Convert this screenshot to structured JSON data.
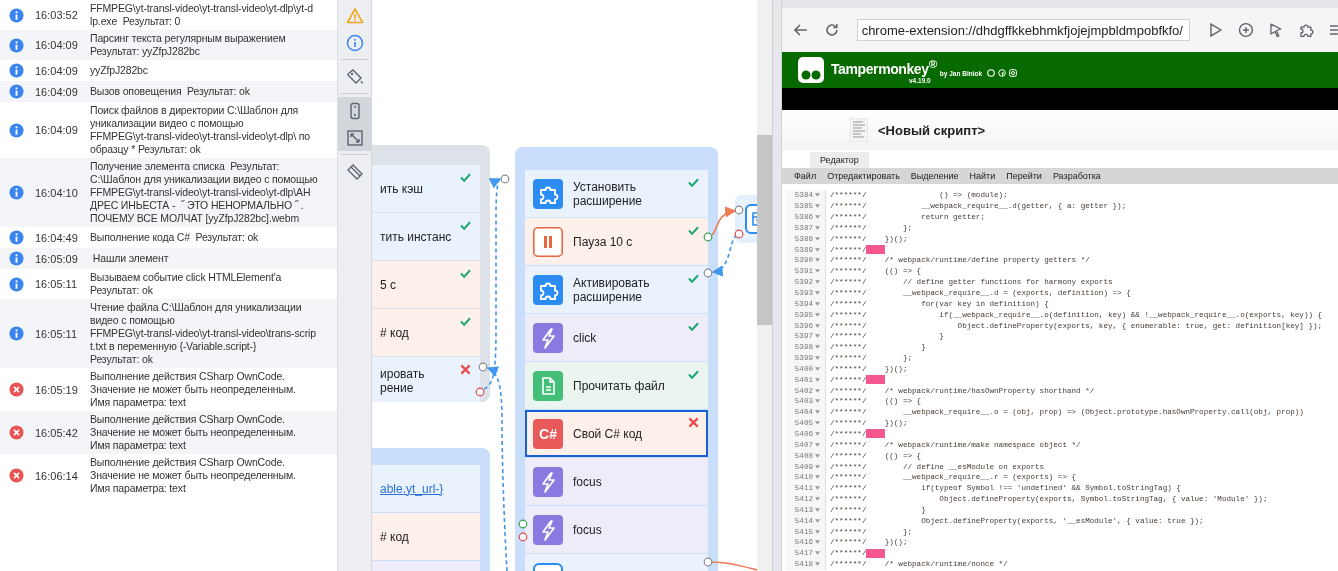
{
  "log": [
    {
      "kind": "info",
      "time": "16:03:52",
      "message": "FFMPEG\\yt-transl-video\\yt-transl-video\\yt-dlp\\yt-d\nlp.exe  Результат: 0"
    },
    {
      "kind": "info",
      "time": "16:04:09",
      "message": "Парсинг текста регулярным выражением\nРезультат: yyZfpJ282bc"
    },
    {
      "kind": "info",
      "time": "16:04:09",
      "message": "yyZfpJ282bc"
    },
    {
      "kind": "info",
      "time": "16:04:09",
      "message": "Вызов оповещения  Результат: ok"
    },
    {
      "kind": "info",
      "time": "16:04:09",
      "message": "Поиск файлов в директории C:\\Шаблон для\nуникализации видео с помощью\nFFMPEG\\yt-transl-video\\yt-transl-video\\yt-dlp\\ по\nобразцу * Результат: ok"
    },
    {
      "kind": "info",
      "time": "16:04:10",
      "message": "Получение элемента списка  Результат:\nC:\\Шаблон для уникализации видео с помощью\nFFMPEG\\yt-transl-video\\yt-transl-video\\yt-dlp\\АН\nДРЕС ИНЬЕСТА -  ˝ ЭТО НЕНОРМАЛЬНО ˝ .\nПОЧЕМУ ВСЕ МОЛЧАТ [yyZfpJ282bc].webm"
    },
    {
      "kind": "info",
      "time": "16:04:49",
      "message": "Выполнение кода C#  Результат: ok"
    },
    {
      "kind": "info",
      "time": "16:05:09",
      "message": " Нашли элемент"
    },
    {
      "kind": "info",
      "time": "16:05:11",
      "message": "Вызываем событие click HTMLElement'a\nРезультат: ok"
    },
    {
      "kind": "info",
      "time": "16:05:11",
      "message": "Чтение файла C:\\Шаблон для уникализации\nвидео с помощью\nFFMPEG\\yt-transl-video\\yt-transl-video\\trans-scrip\nt.txt в переменную {-Variable.script-}\nРезультат: ok"
    },
    {
      "kind": "error",
      "time": "16:05:19",
      "message": "Выполнение действия CSharp OwnCode.\nЗначение не может быть неопределенным.\nИмя параметра: text"
    },
    {
      "kind": "error",
      "time": "16:05:42",
      "message": "Выполнение действия CSharp OwnCode.\nЗначение не может быть неопределенным.\nИмя параметра: text"
    },
    {
      "kind": "error",
      "time": "16:06:14",
      "message": "Выполнение действия CSharp OwnCode.\nЗначение не может быть неопределенным.\nИмя параметра: text"
    }
  ],
  "tool_groups": [
    [
      {
        "kind": "warning",
        "selected": false
      },
      {
        "kind": "info",
        "selected": false
      }
    ],
    [
      {
        "kind": "tag",
        "selected": false
      }
    ],
    [
      {
        "kind": "phone",
        "selected": true
      },
      {
        "kind": "resize",
        "selected": true
      }
    ],
    [
      {
        "kind": "eraser",
        "selected": false
      }
    ]
  ],
  "canvas": {
    "groups": [
      {
        "color": "#dde1e8",
        "items": [
          {
            "kind": "extension",
            "icon": false,
            "link": false,
            "text": "ить кэш",
            "ok": true,
            "error": false,
            "selected": false
          },
          {
            "kind": "extension",
            "icon": false,
            "link": false,
            "text": "тить инстанс",
            "ok": true,
            "error": false,
            "selected": false
          },
          {
            "kind": "pause",
            "icon": false,
            "link": false,
            "text": "5 с",
            "ok": true,
            "error": false,
            "selected": false
          },
          {
            "kind": "csharp",
            "icon": false,
            "link": false,
            "text": "# код",
            "ok": true,
            "error": false,
            "selected": false
          },
          {
            "kind": "extension",
            "icon": false,
            "link": false,
            "text": "ировать\nрение",
            "ok": false,
            "error": true,
            "selected": false
          }
        ]
      },
      {
        "color": "#c8defa",
        "items": [
          {
            "kind": "extension",
            "icon": true,
            "link": false,
            "text": "Установить\nрасширение",
            "ok": true,
            "error": false,
            "selected": false
          },
          {
            "kind": "pause",
            "icon": true,
            "link": false,
            "text": "Пауза 10 с",
            "ok": true,
            "error": false,
            "selected": false
          },
          {
            "kind": "extension",
            "icon": true,
            "link": false,
            "text": "Активировать\nрасширение",
            "ok": true,
            "error": false,
            "selected": false
          },
          {
            "kind": "trigger",
            "icon": true,
            "link": false,
            "text": "click",
            "ok": true,
            "error": false,
            "selected": false
          },
          {
            "kind": "file",
            "icon": true,
            "link": false,
            "text": "Прочитать файл",
            "ok": true,
            "error": false,
            "selected": false
          },
          {
            "kind": "csharp",
            "icon": true,
            "link": false,
            "icon_text": "C#",
            "text": "Свой C# код",
            "ok": false,
            "error": true,
            "selected": true
          },
          {
            "kind": "trigger",
            "icon": true,
            "link": false,
            "text": "focus",
            "ok": false,
            "error": false,
            "selected": false
          },
          {
            "kind": "trigger",
            "icon": true,
            "link": false,
            "text": "focus",
            "ok": false,
            "error": false,
            "selected": false
          },
          {
            "kind": "window",
            "icon": true,
            "link": false,
            "ok": false,
            "error": false,
            "selected": false
          }
        ]
      },
      {
        "color": "#c8defa",
        "items": [
          {
            "kind": "extension",
            "icon": false,
            "link": true,
            "text": "able.yt_url-}",
            "ok": false,
            "error": false,
            "selected": false
          },
          {
            "kind": "csharp",
            "icon": false,
            "link": false,
            "text": "# код",
            "ok": false,
            "error": false,
            "selected": false
          },
          {
            "kind": "trigger",
            "icon": false,
            "link": false,
            "ok": false,
            "error": false,
            "selected": false
          }
        ]
      },
      {
        "color": "#e3effc",
        "items": [
          {
            "kind": "window",
            "icon": true,
            "link": false,
            "ok": false,
            "error": false,
            "selected": false
          }
        ]
      }
    ]
  },
  "browser": {
    "url": "chrome-extension://dhdgffkkebhmkfjojejmpbldmpobfkfo/",
    "brand": "Tampermonkey$^{®}$",
    "byline": "by Jan Biniok",
    "version": "v4.19.0",
    "script_title": "<Новый скрипт>",
    "tabs": [
      {
        "label": "Редактор",
        "selected": true
      }
    ],
    "menu": [
      "Файл",
      "Отредактировать",
      "Выделение",
      "Найти",
      "Перейти",
      "Разработка"
    ],
    "code_lines": [
      {
        "number": "5384",
        "text": "/******/                () => (module);",
        "trailing_space": false
      },
      {
        "number": "5385",
        "text": "/******/            __webpack_require__.d(getter, { a: getter });",
        "trailing_space": false
      },
      {
        "number": "5386",
        "text": "/******/            return getter;",
        "trailing_space": false
      },
      {
        "number": "5387",
        "text": "/******/        };",
        "trailing_space": false
      },
      {
        "number": "5388",
        "text": "/******/    })();",
        "trailing_space": false
      },
      {
        "number": "5389",
        "text": "/******/",
        "trailing_space": true
      },
      {
        "number": "5390",
        "text": "/******/    /* webpack/runtime/define property getters */",
        "trailing_space": false
      },
      {
        "number": "5391",
        "text": "/******/    (() => {",
        "trailing_space": false
      },
      {
        "number": "5392",
        "text": "/******/        // define getter functions for harmony exports",
        "trailing_space": false
      },
      {
        "number": "5393",
        "text": "/******/        __webpack_require__.d = (exports, definition) => {",
        "trailing_space": false
      },
      {
        "number": "5394",
        "text": "/******/            for(var key in definition) {",
        "trailing_space": false
      },
      {
        "number": "5395",
        "text": "/******/                if(__webpack_require__.o(definition, key) && !__webpack_require__.o(exports, key)) {",
        "trailing_space": false
      },
      {
        "number": "5396",
        "text": "/******/                    Object.defineProperty(exports, key, { enumerable: true, get: definition[key] });",
        "trailing_space": false
      },
      {
        "number": "5397",
        "text": "/******/                }",
        "trailing_space": false
      },
      {
        "number": "5398",
        "text": "/******/            }",
        "trailing_space": false
      },
      {
        "number": "5399",
        "text": "/******/        };",
        "trailing_space": false
      },
      {
        "number": "5400",
        "text": "/******/    })();",
        "trailing_space": false
      },
      {
        "number": "5401",
        "text": "/******/",
        "trailing_space": true
      },
      {
        "number": "5402",
        "text": "/******/    /* webpack/runtime/hasOwnProperty shorthand */",
        "trailing_space": false
      },
      {
        "number": "5403",
        "text": "/******/    (() => {",
        "trailing_space": false
      },
      {
        "number": "5404",
        "text": "/******/        __webpack_require__.o = (obj, prop) => (Object.prototype.hasOwnProperty.call(obj, prop))",
        "trailing_space": false
      },
      {
        "number": "5405",
        "text": "/******/    })();",
        "trailing_space": false
      },
      {
        "number": "5406",
        "text": "/******/",
        "trailing_space": true
      },
      {
        "number": "5407",
        "text": "/******/    /* webpack/runtime/make namespace object */",
        "trailing_space": false
      },
      {
        "number": "5408",
        "text": "/******/    (() => {",
        "trailing_space": false
      },
      {
        "number": "5409",
        "text": "/******/        // define __esModule on exports",
        "trailing_space": false
      },
      {
        "number": "5410",
        "text": "/******/        __webpack_require__.r = (exports) => {",
        "trailing_space": false
      },
      {
        "number": "5411",
        "text": "/******/            if(typeof Symbol !== 'undefined' && Symbol.toStringTag) {",
        "trailing_space": false
      },
      {
        "number": "5412",
        "text": "/******/                Object.defineProperty(exports, Symbol.toStringTag, { value: 'Module' });",
        "trailing_space": false
      },
      {
        "number": "5413",
        "text": "/******/            }",
        "trailing_space": false
      },
      {
        "number": "5414",
        "text": "/******/            Object.defineProperty(exports, '__esModule', { value: true });",
        "trailing_space": false
      },
      {
        "number": "5415",
        "text": "/******/        };",
        "trailing_space": false
      },
      {
        "number": "5416",
        "text": "/******/    })();",
        "trailing_space": false
      },
      {
        "number": "5417",
        "text": "/******/",
        "trailing_space": true
      },
      {
        "number": "5418",
        "text": "/******/    /* webpack/runtime/nonce */",
        "trailing_space": false
      }
    ]
  }
}
